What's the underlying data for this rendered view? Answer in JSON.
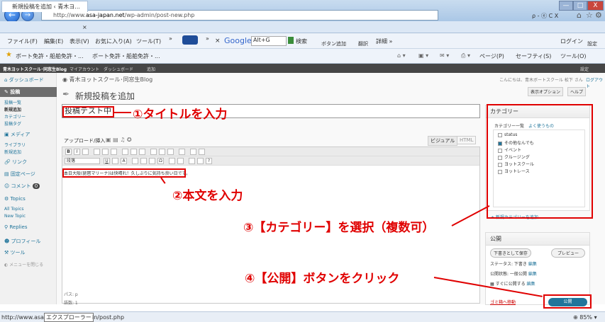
{
  "browser": {
    "url_prefix": "http://www.",
    "url_domain": "asa-japan.net",
    "url_path": "/wp-admin/post-new.php",
    "tab_title": "新規投稿を追加 ‹ 青木ヨ...",
    "search_hint": "ρ - ⓔ C X",
    "win_min": "—",
    "win_max": "□",
    "win_close": "X"
  },
  "menu": {
    "file": "ファイル(F)",
    "edit": "編集(E)",
    "view": "表示(V)",
    "favorites": "お気に入り(A)",
    "tools": "ツール(T)",
    "more": "»",
    "google": "Google",
    "alt_g": "Alt+G",
    "search_btn": "検索",
    "bookmark_btn": "ボタン追加",
    "translate": "翻訳",
    "detail": "詳細 »",
    "login": "ログイン",
    "settings": "設定"
  },
  "favorites": {
    "item1": "ボート免許・船舶免許・...",
    "item2": "ボート免許・船舶免許・...",
    "page": "ページ(P)",
    "safety": "セーフティ(S)",
    "tools": "ツール(O)"
  },
  "wpbar": {
    "site": "青木ヨットスクール･同窓生Blog",
    "account": "マイアカウント",
    "dashboard": "ダッシュボード",
    "new": "追加",
    "settings": "設定"
  },
  "sidebar": {
    "dashboard": "ダッシュボード",
    "posts": "投稿",
    "posts_list": "投稿一覧",
    "new_post": "新規追加",
    "category": "カテゴリー",
    "tags": "投稿タグ",
    "media": "メディア",
    "library": "ライブラリ",
    "media_new": "新規追加",
    "links": "リンク",
    "pages": "固定ページ",
    "comments": "コメント",
    "comment_count": "0",
    "topics": "Topics",
    "all_topics": "All Topics",
    "new_topic": "New Topic",
    "replies": "Replies",
    "profile": "プロフィール",
    "tools": "ツール",
    "collapse": "メニューを閉じる"
  },
  "page": {
    "site_name": "青木ヨットスクール･同窓生Blog",
    "greeting": "こんにちは、青木ボートスクール 松下 さん",
    "logout": "ログアウト",
    "screen_options": "表示オプション",
    "help": "ヘルプ",
    "heading": "新規投稿を追加",
    "post_title": "投稿テスト中",
    "upload_label": "アップロード/挿入",
    "visual_tab": "ビジュアル",
    "html_tab": "HTML",
    "format_select": "段落",
    "body_text": "本日大阪(琵琶マリーナ)は快晴れ！久しぶりに気持ち良い日です。",
    "path": "パス: p",
    "word_count": "語数: 1"
  },
  "categories": {
    "title": "カテゴリー",
    "tab_all": "カテゴリー一覧",
    "tab_popular": "よく使うもの",
    "items": [
      "status",
      "その他なんでも",
      "イベント",
      "クルージング",
      "ヨットスクール",
      "ヨットレース"
    ],
    "checked": "その他なんでも",
    "add_new": "+ 新規カテゴリーを追加"
  },
  "publish": {
    "title": "公開",
    "save_draft": "下書きとして保存",
    "preview": "プレビュー",
    "status": "ステータス: 下書き",
    "status_edit": "編集",
    "visibility": "公開状態: 一般公開",
    "visibility_edit": "編集",
    "schedule": "すぐに公開する",
    "schedule_edit": "編集",
    "trash": "ゴミ箱へ移動",
    "publish_btn": "公開"
  },
  "annotations": {
    "a1": "①タイトルを入力",
    "a2": "②本文を入力",
    "a3": "③【カテゴリー】を選択（複数可）",
    "a4": "④【公開】ボタンをクリック"
  },
  "statusbar": {
    "url_part1": "http://www.asa-",
    "tooltip": "エクスプローラー",
    "url_part2": "in/post.php",
    "zoom": "85%"
  },
  "colors": {
    "annotation_red": "#e00000",
    "wp_link": "#21759b",
    "publish_blue": "#21759b"
  }
}
